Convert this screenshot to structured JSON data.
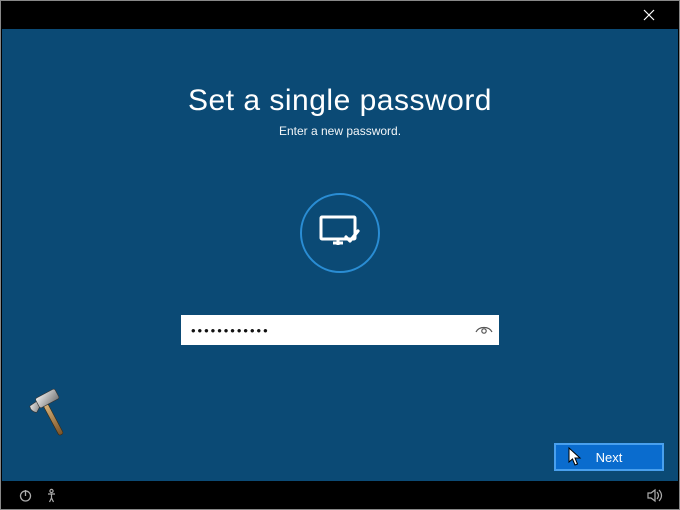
{
  "heading": "Set a single password",
  "subheading": "Enter a new password.",
  "password_mask": "••••••••••••",
  "next_label": "Next",
  "icons": {
    "close": "close-icon",
    "monitor_check": "monitor-check-icon",
    "reveal": "eye-reveal-icon",
    "power": "power-icon",
    "accessibility": "accessibility-icon",
    "volume": "volume-icon",
    "hammer": "hammer-icon",
    "cursor": "cursor-icon"
  }
}
